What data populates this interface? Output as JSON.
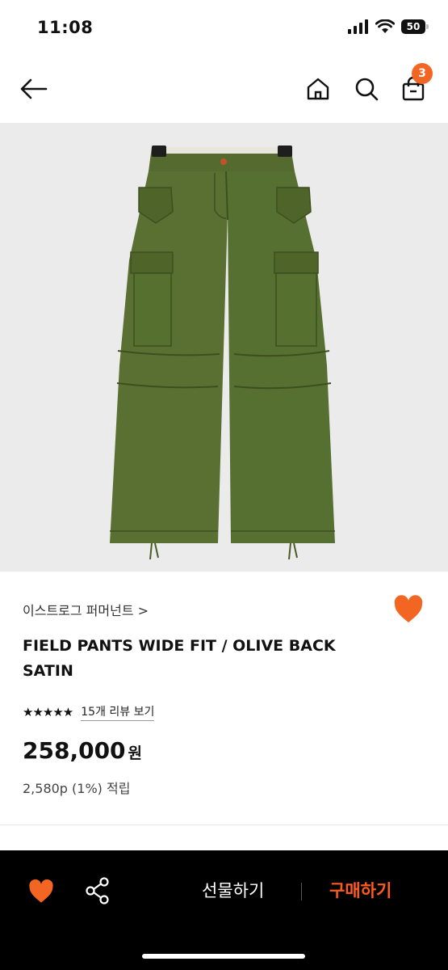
{
  "status_bar": {
    "time": "11:08",
    "battery": "50"
  },
  "nav": {
    "back_icon": "arrow-left-icon",
    "home_icon": "home-icon",
    "search_icon": "search-icon",
    "cart_icon": "shopping-bag-icon",
    "cart_count": "3"
  },
  "product": {
    "brand": "이스트로그 퍼머넌트 >",
    "name": "FIELD PANTS WIDE FIT / OLIVE BACK SATIN",
    "stars": "★★★★★",
    "review_link": "15개 리뷰 보기",
    "price": "258,000",
    "currency": "원",
    "points": "2,580p (1%) 적립"
  },
  "bottom_bar": {
    "gift_label": "선물하기",
    "buy_label": "구매하기"
  },
  "colors": {
    "accent": "#f26522",
    "buy": "#ff5a1f",
    "olive": "#556b2f"
  }
}
